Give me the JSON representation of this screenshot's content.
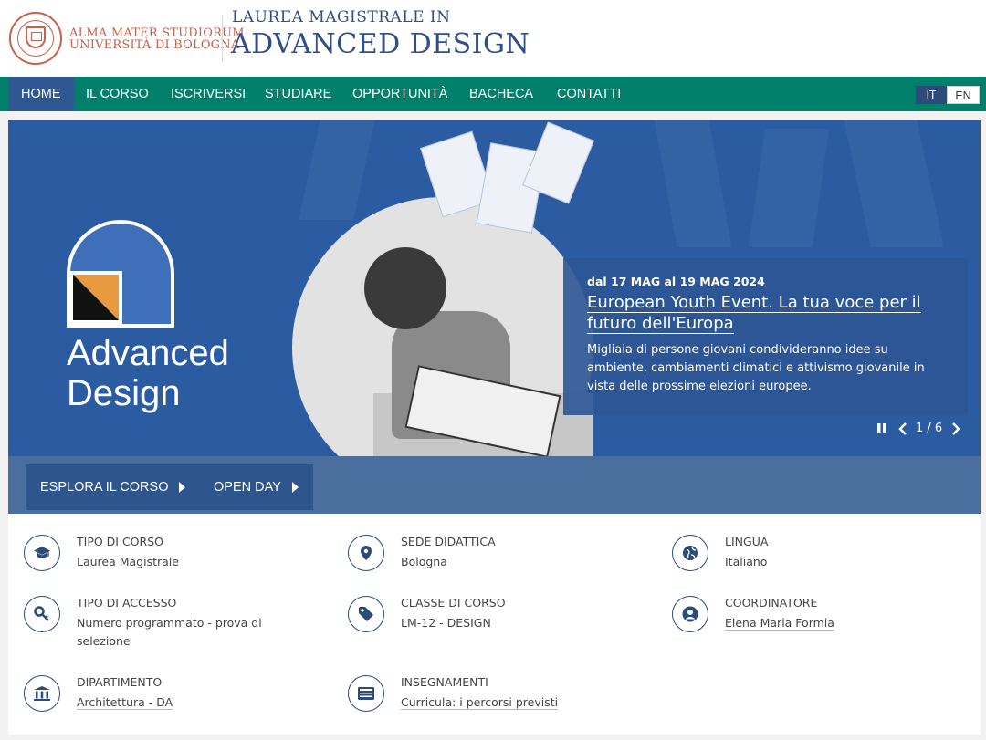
{
  "header": {
    "univ_line1": "ALMA MATER STUDIORUM",
    "univ_line2": "UNIVERSITÀ DI BOLOGNA",
    "course_sub": "LAUREA MAGISTRALE IN",
    "course_title": "ADVANCED DESIGN"
  },
  "nav": {
    "items": [
      "HOME",
      "IL CORSO",
      "ISCRIVERSI",
      "STUDIARE",
      "OPPORTUNITÀ",
      "BACHECA",
      "CONTATTI"
    ],
    "active": "HOME",
    "lang_it": "IT",
    "lang_en": "EN"
  },
  "hero": {
    "logo_line1": "Advanced",
    "logo_line2": "Design",
    "event_date": "dal 17 MAG al 19 MAG 2024",
    "event_title": "European Youth Event. La tua voce per il futuro dell'Europa",
    "event_desc": "Migliaia di persone giovani condivideranno idee su ambiente, cambiamenti climatici e attivismo giovanile in vista delle prossime elezioni europee.",
    "counter": "1 / 6",
    "btn_explore": "ESPLORA IL CORSO",
    "btn_openday": "OPEN DAY"
  },
  "info": {
    "tipo_corso": {
      "label": "TIPO DI CORSO",
      "value": "Laurea Magistrale"
    },
    "sede": {
      "label": "SEDE DIDATTICA",
      "value": "Bologna"
    },
    "lingua": {
      "label": "LINGUA",
      "value": "Italiano"
    },
    "accesso": {
      "label": "TIPO DI ACCESSO",
      "value": "Numero programmato - prova di selezione"
    },
    "classe": {
      "label": "CLASSE DI CORSO",
      "value": "LM-12 - DESIGN"
    },
    "coordinatore": {
      "label": "COORDINATORE",
      "value": "Elena Maria Formia"
    },
    "dipartimento": {
      "label": "DIPARTIMENTO",
      "value": "Architettura - DA"
    },
    "insegnamenti": {
      "label": "INSEGNAMENTI",
      "value": "Curricula: i percorsi previsti"
    }
  },
  "colors": {
    "nav_green": "#00806b",
    "brand_blue": "#2f4f88",
    "hero_blue": "#2b5ba0",
    "seal_red": "#c8614a"
  }
}
